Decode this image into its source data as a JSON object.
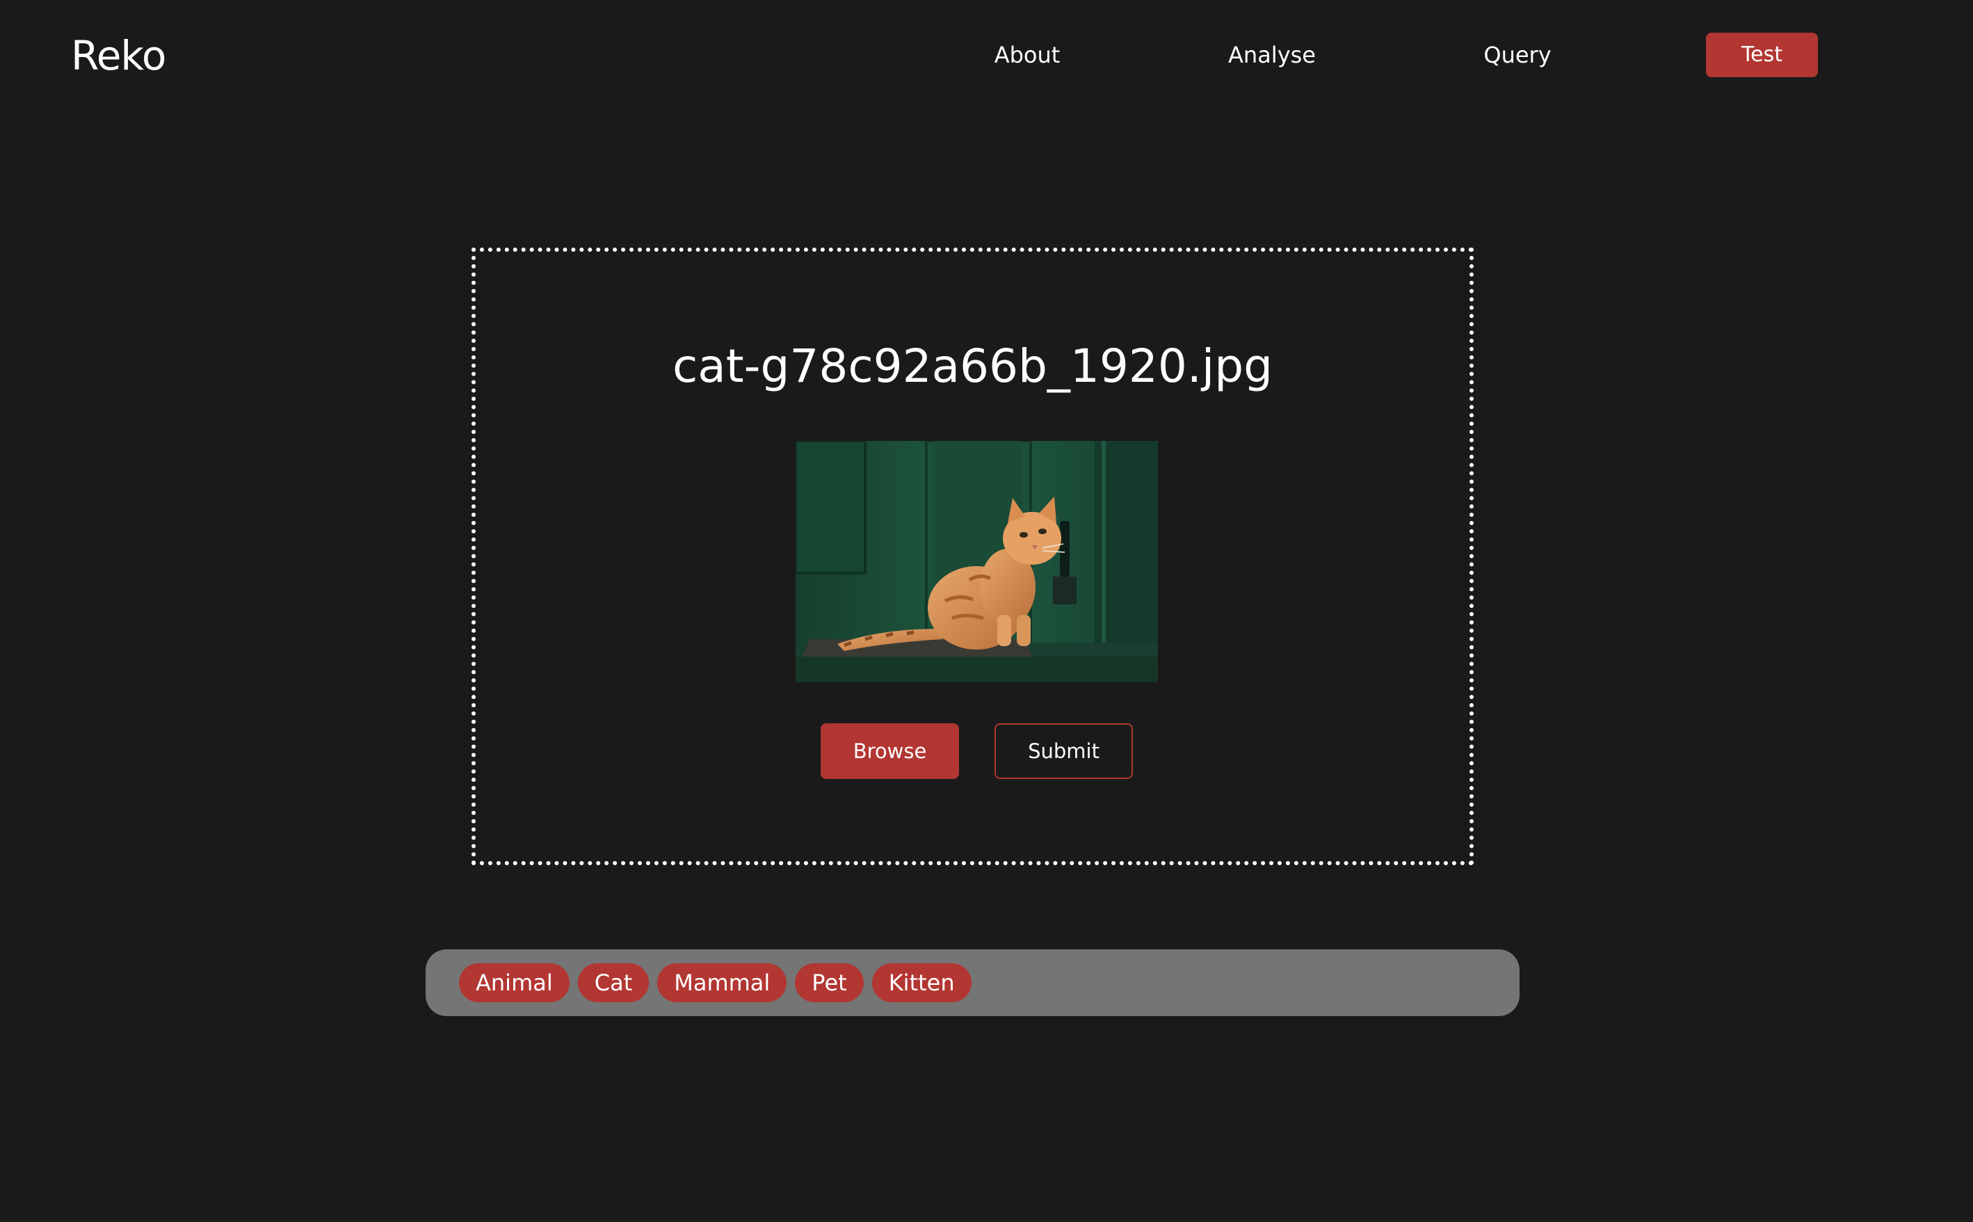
{
  "brand": {
    "title": "Reko"
  },
  "nav": {
    "about": "About",
    "analyse": "Analyse",
    "query": "Query",
    "test": "Test"
  },
  "upload": {
    "file_name": "cat-g78c92a66b_1920.jpg",
    "browse_label": "Browse",
    "submit_label": "Submit"
  },
  "labels": {
    "items": [
      "Animal",
      "Cat",
      "Mammal",
      "Pet",
      "Kitten"
    ]
  },
  "colors": {
    "background": "#1a1a1a",
    "accent": "#b23632",
    "label_bar": "#757575",
    "text": "#ffffff"
  },
  "icons": {
    "preview": "cat-photo-image"
  }
}
